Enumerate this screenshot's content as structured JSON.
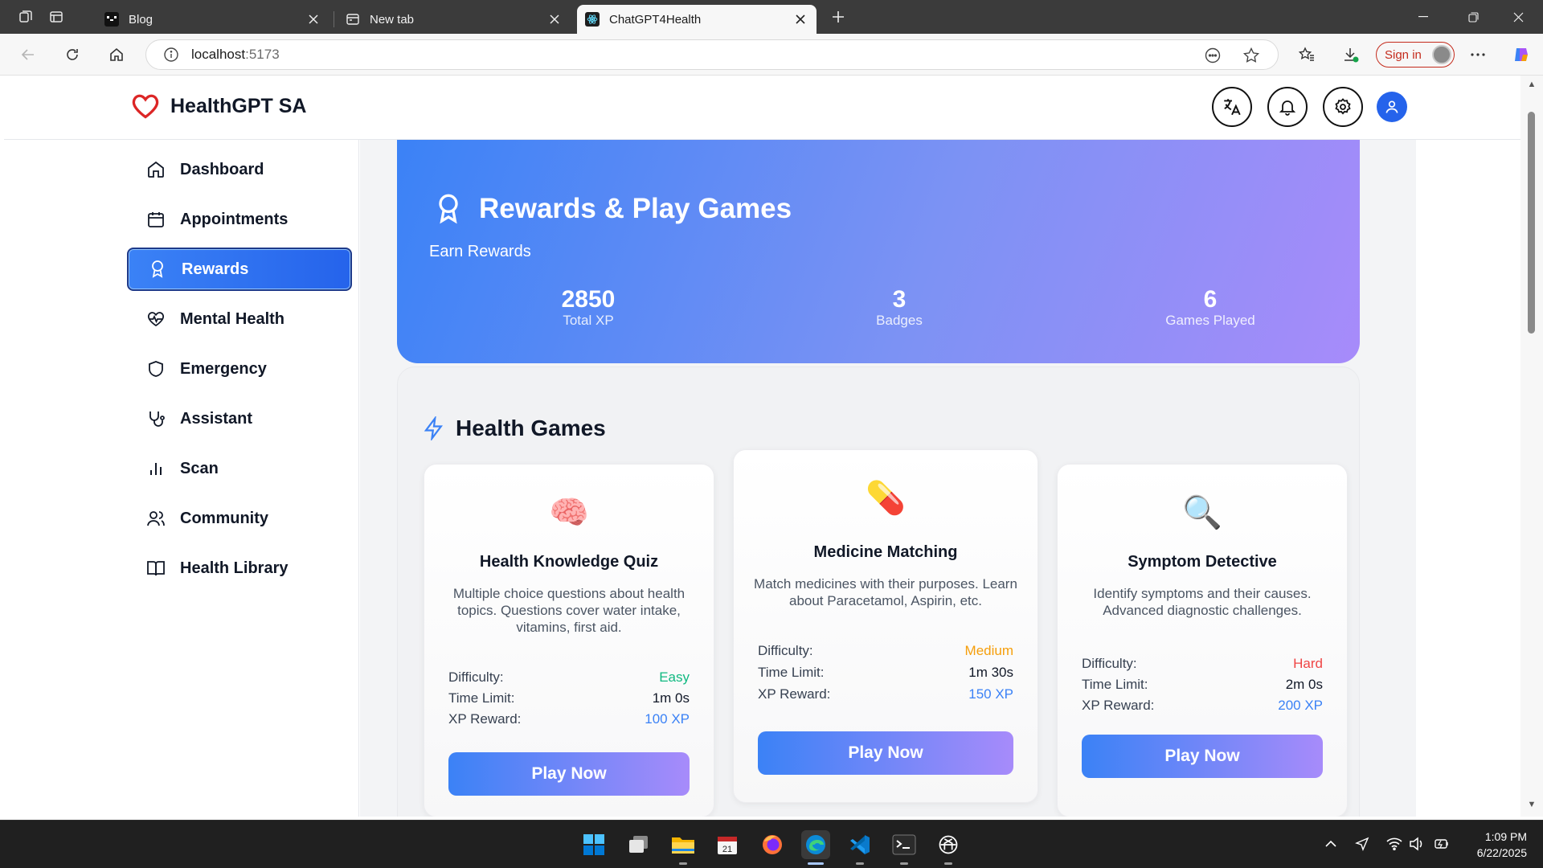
{
  "browser": {
    "tabs": [
      {
        "title": "Blog"
      },
      {
        "title": "New tab"
      },
      {
        "title": "ChatGPT4Health"
      }
    ],
    "url_host": "localhost",
    "url_port": ":5173",
    "signin_label": "Sign in"
  },
  "app": {
    "brand": "HealthGPT SA",
    "nav": [
      {
        "label": "Dashboard"
      },
      {
        "label": "Appointments"
      },
      {
        "label": "Rewards"
      },
      {
        "label": "Mental Health"
      },
      {
        "label": "Emergency"
      },
      {
        "label": "Assistant"
      },
      {
        "label": "Scan"
      },
      {
        "label": "Community"
      },
      {
        "label": "Health Library"
      }
    ],
    "active_nav": "Rewards"
  },
  "hero": {
    "title": "Rewards & Play Games",
    "subtitle": "Earn Rewards",
    "stats": [
      {
        "value": "2850",
        "label": "Total XP"
      },
      {
        "value": "3",
        "label": "Badges"
      },
      {
        "value": "6",
        "label": "Games Played"
      }
    ]
  },
  "games": {
    "heading": "Health Games",
    "difficulty_label": "Difficulty:",
    "time_label": "Time Limit:",
    "xp_label": "XP Reward:",
    "play_label": "Play Now",
    "cards": [
      {
        "emoji": "🧠",
        "title": "Health Knowledge Quiz",
        "description": "Multiple choice questions about health topics. Questions cover water intake, vitamins, first aid.",
        "difficulty": "Easy",
        "time_limit": "1m 0s",
        "xp": "100 XP"
      },
      {
        "emoji": "💊",
        "title": "Medicine Matching",
        "description": "Match medicines with their purposes. Learn about Paracetamol, Aspirin, etc.",
        "difficulty": "Medium",
        "time_limit": "1m 30s",
        "xp": "150 XP"
      },
      {
        "emoji": "🔍",
        "title": "Symptom Detective",
        "description": "Identify symptoms and their causes. Advanced diagnostic challenges.",
        "difficulty": "Hard",
        "time_limit": "2m 0s",
        "xp": "200 XP"
      }
    ]
  },
  "taskbar": {
    "time": "1:09 PM",
    "date": "6/22/2025"
  },
  "colors": {
    "primary": "#3b82f6",
    "accent": "#a78bfa",
    "easy": "#10b981",
    "medium": "#f59e0b",
    "hard": "#ef4444"
  }
}
